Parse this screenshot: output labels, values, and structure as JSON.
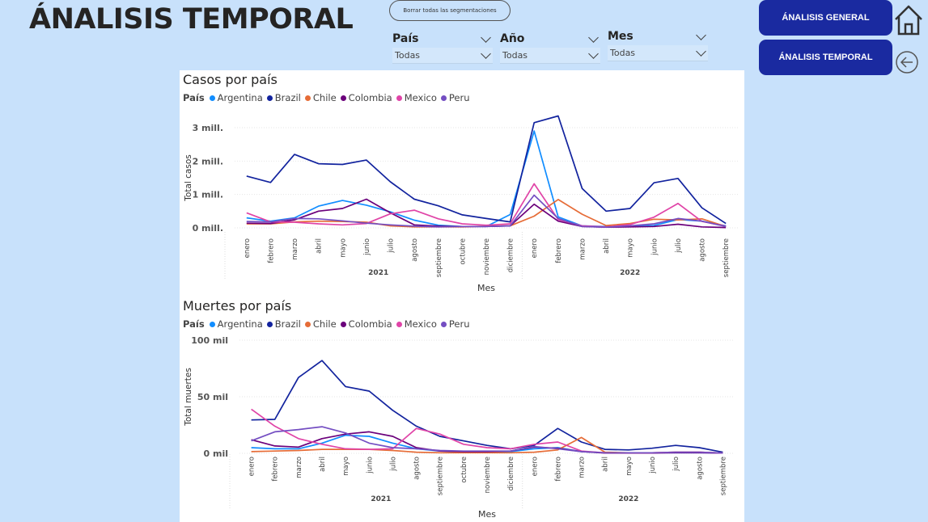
{
  "header": {
    "title": "ÁNALISIS TEMPORAL"
  },
  "clear_button": "Borrar todas las segmentaciones",
  "slicers": [
    {
      "title": "País",
      "value": "Todas"
    },
    {
      "title": "Año",
      "value": "Todas"
    },
    {
      "title": "Mes",
      "value": "Todas"
    }
  ],
  "nav": {
    "general": "ÁNALISIS GENERAL",
    "temporal": "ÁNALISIS TEMPORAL",
    "home_icon": "home-icon",
    "back_icon": "back-arrow-icon"
  },
  "legend_title": "País",
  "chart_data": [
    {
      "type": "line",
      "title": "Casos por país",
      "xlabel": "Mes",
      "ylabel": "Total casos",
      "ytick_labels": [
        "0 mill.",
        "1 mill.",
        "2 mill.",
        "3 mill."
      ],
      "yticks": [
        0,
        1000000,
        2000000,
        3000000
      ],
      "ylim": [
        0,
        3500000
      ],
      "x": [
        "enero",
        "febrero",
        "marzo",
        "abril",
        "mayo",
        "junio",
        "julio",
        "agosto",
        "septiembre",
        "octubre",
        "noviembre",
        "diciembre",
        "enero",
        "febrero",
        "marzo",
        "abril",
        "mayo",
        "junio",
        "julio",
        "agosto",
        "septiembre"
      ],
      "year_groups": [
        {
          "label": "2021",
          "start": 0,
          "end": 11
        },
        {
          "label": "2022",
          "start": 12,
          "end": 20
        }
      ],
      "grid": true,
      "legend": "top-left",
      "series": [
        {
          "name": "Argentina",
          "color": "#118dff",
          "values": [
            300000,
            200000,
            300000,
            650000,
            820000,
            680000,
            480000,
            230000,
            80000,
            40000,
            40000,
            400000,
            2900000,
            330000,
            60000,
            40000,
            40000,
            70000,
            250000,
            200000,
            60000
          ]
        },
        {
          "name": "Brazil",
          "color": "#12239e",
          "values": [
            1550000,
            1360000,
            2200000,
            1920000,
            1900000,
            2030000,
            1380000,
            860000,
            660000,
            390000,
            280000,
            180000,
            3150000,
            3350000,
            1180000,
            500000,
            580000,
            1350000,
            1480000,
            600000,
            130000
          ]
        },
        {
          "name": "Chile",
          "color": "#e66c37",
          "values": [
            120000,
            120000,
            180000,
            200000,
            190000,
            170000,
            60000,
            30000,
            30000,
            30000,
            50000,
            60000,
            350000,
            850000,
            410000,
            70000,
            130000,
            260000,
            240000,
            270000,
            40000
          ]
        },
        {
          "name": "Colombia",
          "color": "#6b007b",
          "values": [
            140000,
            130000,
            240000,
            500000,
            580000,
            860000,
            450000,
            90000,
            50000,
            40000,
            40000,
            60000,
            710000,
            200000,
            40000,
            20000,
            30000,
            40000,
            110000,
            30000,
            10000
          ]
        },
        {
          "name": "Mexico",
          "color": "#e044a7",
          "values": [
            450000,
            180000,
            170000,
            120000,
            90000,
            130000,
            420000,
            530000,
            270000,
            120000,
            80000,
            120000,
            1320000,
            250000,
            60000,
            30000,
            100000,
            320000,
            730000,
            190000,
            50000
          ]
        },
        {
          "name": "Peru",
          "color": "#744ec2",
          "values": [
            190000,
            180000,
            280000,
            270000,
            210000,
            140000,
            90000,
            50000,
            30000,
            40000,
            40000,
            60000,
            980000,
            280000,
            40000,
            20000,
            60000,
            120000,
            280000,
            200000,
            40000
          ]
        }
      ]
    },
    {
      "type": "line",
      "title": "Muertes por país",
      "xlabel": "Mes",
      "ylabel": "Total muertes",
      "ytick_labels": [
        "0 mil",
        "50 mil",
        "100 mil"
      ],
      "yticks": [
        0,
        50000,
        100000
      ],
      "ylim": [
        0,
        100000
      ],
      "x": [
        "enero",
        "febrero",
        "marzo",
        "abril",
        "mayo",
        "junio",
        "julio",
        "agosto",
        "septiembre",
        "octubre",
        "noviembre",
        "diciembre",
        "enero",
        "febrero",
        "marzo",
        "abril",
        "mayo",
        "junio",
        "julio",
        "agosto",
        "septiembre"
      ],
      "year_groups": [
        {
          "label": "2021",
          "start": 0,
          "end": 11
        },
        {
          "label": "2022",
          "start": 12,
          "end": 20
        }
      ],
      "grid": true,
      "legend": "top-left",
      "series": [
        {
          "name": "Argentina",
          "color": "#118dff",
          "values": [
            5000,
            4000,
            4000,
            9000,
            16000,
            15000,
            9000,
            4000,
            2000,
            1500,
            1000,
            1500,
            4000,
            5000,
            1500,
            500,
            500,
            500,
            500,
            500,
            300
          ]
        },
        {
          "name": "Brazil",
          "color": "#12239e",
          "values": [
            29500,
            30000,
            67000,
            82000,
            59000,
            55000,
            38000,
            24000,
            15000,
            11000,
            7000,
            4000,
            7000,
            22000,
            10000,
            3500,
            3000,
            4500,
            7000,
            5000,
            1000
          ]
        },
        {
          "name": "Chile",
          "color": "#e66c37",
          "values": [
            1500,
            2000,
            2500,
            3500,
            3500,
            3500,
            2500,
            1000,
            500,
            500,
            500,
            500,
            1000,
            3000,
            14000,
            1000,
            500,
            500,
            1000,
            1000,
            300
          ]
        },
        {
          "name": "Colombia",
          "color": "#6b007b",
          "values": [
            12000,
            6500,
            5500,
            13000,
            17000,
            19000,
            15000,
            5000,
            2000,
            1500,
            1500,
            2000,
            5500,
            4500,
            1500,
            300,
            300,
            300,
            500,
            500,
            200
          ]
        },
        {
          "name": "Mexico",
          "color": "#e044a7",
          "values": [
            39000,
            24000,
            13000,
            8000,
            4000,
            3500,
            4000,
            22000,
            17000,
            8000,
            5000,
            4000,
            8000,
            10000,
            2000,
            500,
            500,
            500,
            1000,
            1000,
            300
          ]
        },
        {
          "name": "Peru",
          "color": "#744ec2",
          "values": [
            11000,
            19000,
            21000,
            23500,
            18000,
            9000,
            5000,
            4000,
            2500,
            2000,
            2000,
            2000,
            6000,
            4000,
            1500,
            500,
            500,
            500,
            1000,
            1000,
            300
          ]
        }
      ]
    }
  ]
}
